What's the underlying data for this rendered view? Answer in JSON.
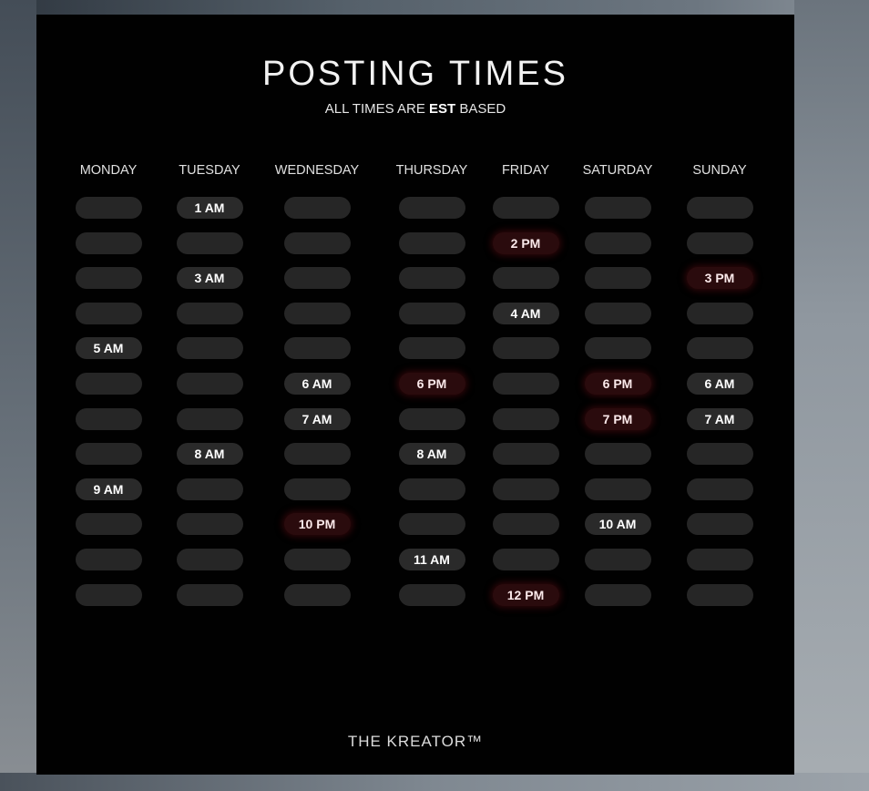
{
  "title": "POSTING TIMES",
  "subtitle": {
    "prefix": "ALL TIMES ARE",
    "emphasis": "EST",
    "suffix": "BASED"
  },
  "footer": "THE KREATOR™",
  "colors": {
    "panel": "#010101",
    "empty_slot": "#262626",
    "am_slot": "#2a2a2a",
    "pm_slot": "#2a0b0d",
    "text": "#ffffff"
  },
  "schedule": [
    {
      "day": "MONDAY",
      "slots": [
        "",
        "",
        "",
        "",
        "5 AM",
        "",
        "",
        "",
        "9 AM",
        "",
        "",
        ""
      ]
    },
    {
      "day": "TUESDAY",
      "slots": [
        "1 AM",
        "",
        "3 AM",
        "",
        "",
        "",
        "",
        "8 AM",
        "",
        "",
        "",
        ""
      ]
    },
    {
      "day": "WEDNESDAY",
      "slots": [
        "",
        "",
        "",
        "",
        "",
        "6 AM",
        "7 AM",
        "",
        "",
        "10 PM",
        "",
        ""
      ]
    },
    {
      "day": "THURSDAY",
      "slots": [
        "",
        "",
        "",
        "",
        "",
        "6 PM",
        "",
        "8 AM",
        "",
        "",
        "11 AM",
        ""
      ]
    },
    {
      "day": "FRIDAY",
      "slots": [
        "",
        "2 PM",
        "",
        "4 AM",
        "",
        "",
        "",
        "",
        "",
        "",
        "",
        "12 PM"
      ]
    },
    {
      "day": "SATURDAY",
      "slots": [
        "",
        "",
        "",
        "",
        "",
        "6 PM",
        "7 PM",
        "",
        "",
        "10 AM",
        "",
        ""
      ]
    },
    {
      "day": "SUNDAY",
      "slots": [
        "",
        "",
        "3 PM",
        "",
        "",
        "6 AM",
        "7 AM",
        "",
        "",
        "",
        "",
        ""
      ]
    }
  ]
}
